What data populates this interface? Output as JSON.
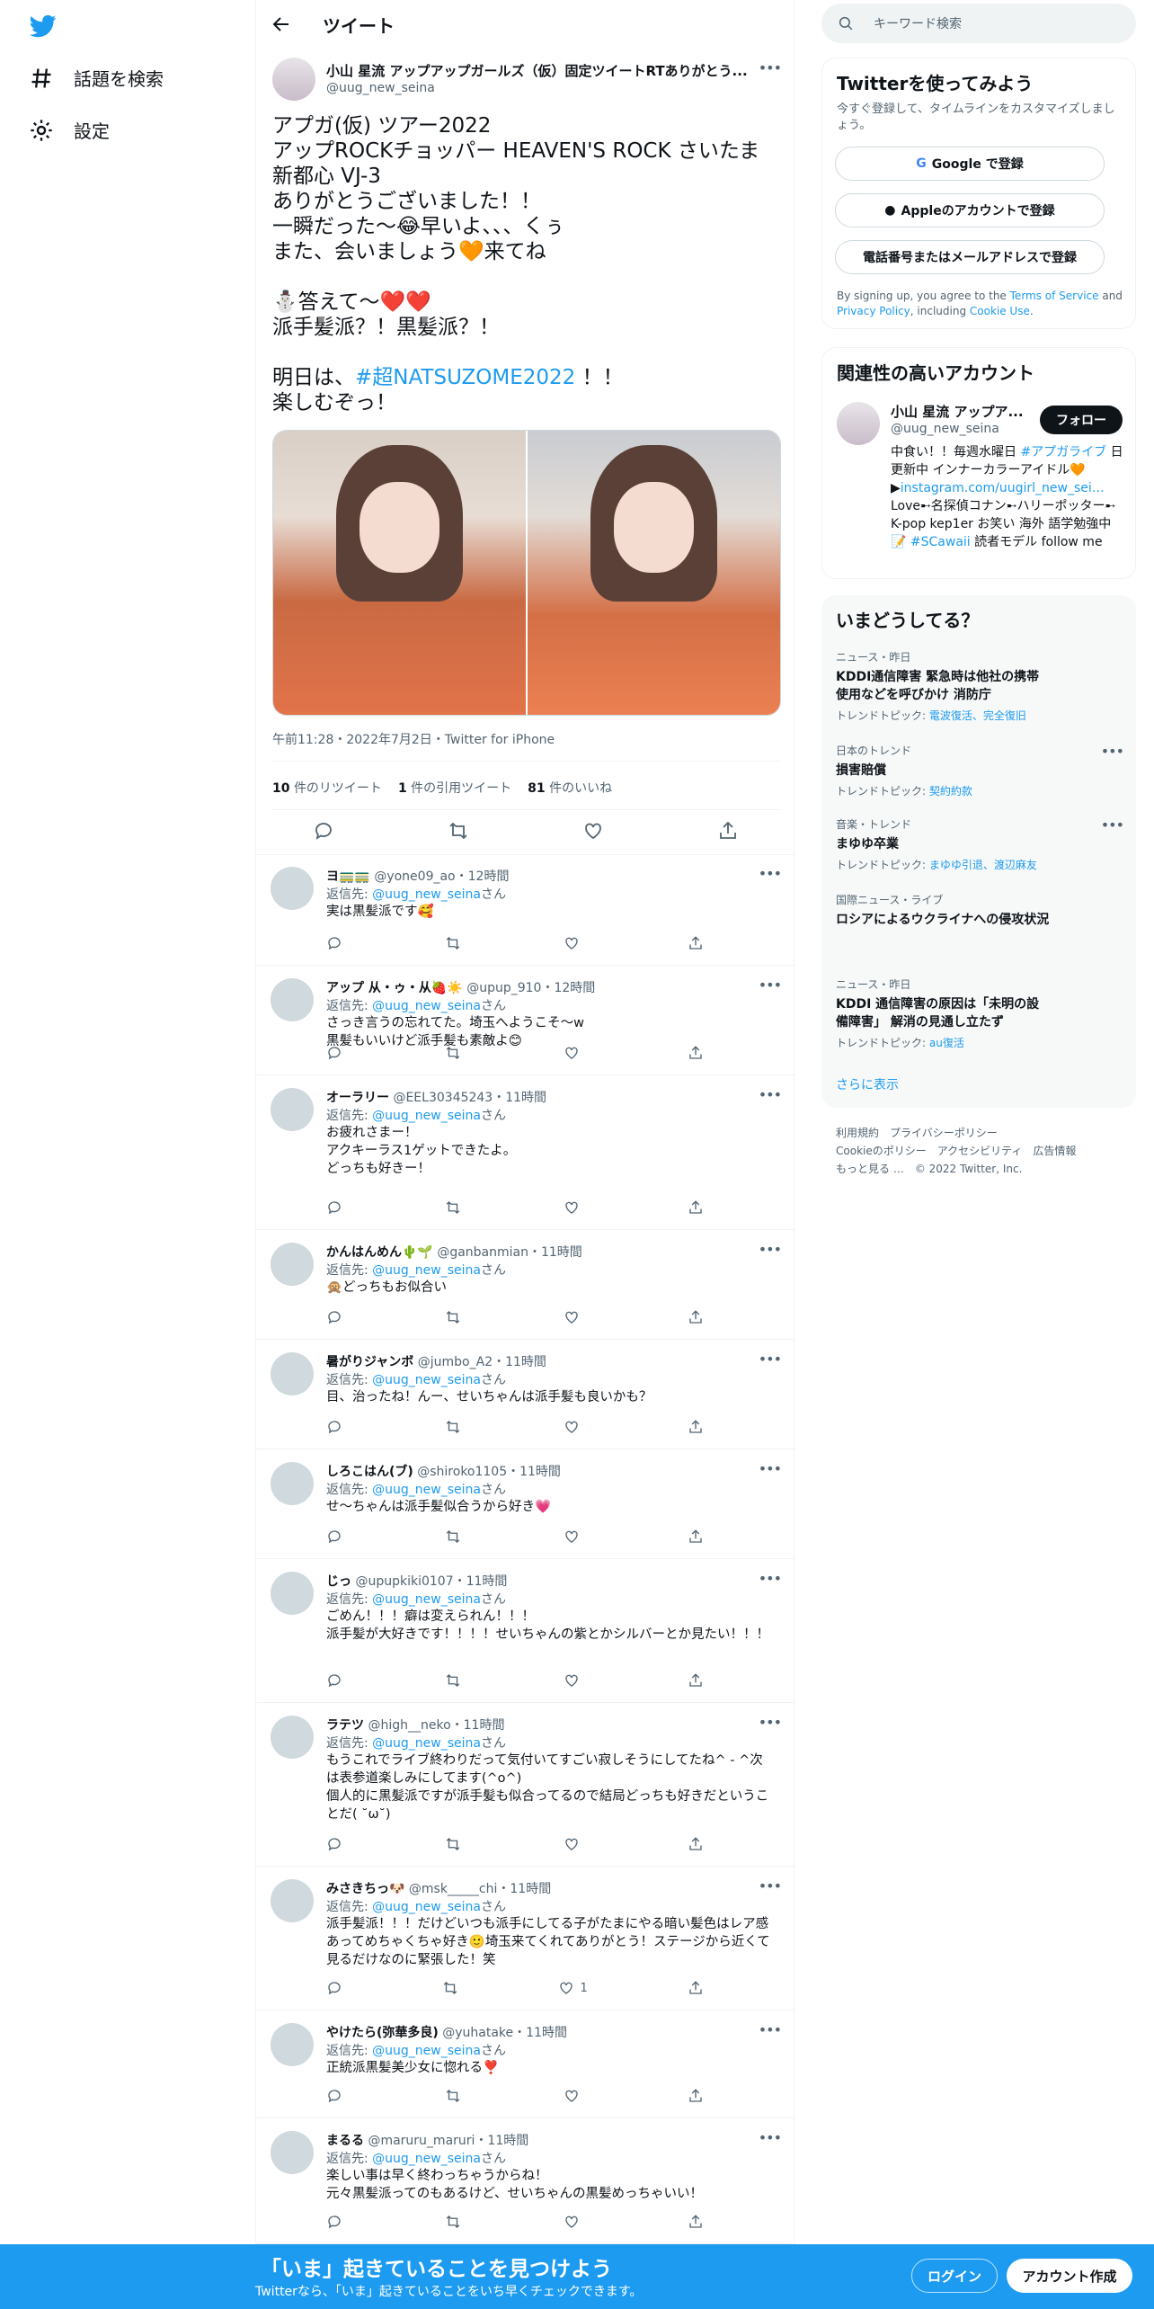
{
  "nav": {
    "explore_label": "話題を検索",
    "settings_label": "設定"
  },
  "header": {
    "title": "ツイート"
  },
  "tweet": {
    "author_name": "小山 星流 アップアップガールズ（仮）固定ツイートRTありがとう...",
    "author_handle": "@uug_new_seina",
    "body_lines": [
      "アプガ(仮) ツアー2022",
      "アップROCKチョッパー HEAVEN'S ROCK さいたま",
      "新都心 VJ-3",
      "ありがとうございました！！",
      "一瞬だった〜😂早いよ、、、くぅ",
      "また、会いましょう🧡来てね",
      "",
      "⛄答えて〜❤️❤️",
      "派手髪派？！黒髪派？！",
      ""
    ],
    "hashtag_prefix": "明日は、",
    "hashtag": "#超NATSUZOME2022",
    "hashtag_suffix": " ！！",
    "last_line": "楽しむぞっ！",
    "meta": "午前11:28・2022年7月2日・Twitter for iPhone",
    "retweets_count": "10",
    "retweets_label": "件のリツイート",
    "quotes_count": "1",
    "quotes_label": "件の引用ツイート",
    "likes_count": "81",
    "likes_label": "件のいいね"
  },
  "replies": [
    {
      "name": "ヨ🚃🚃",
      "handle": "@yone09_ao・12時間",
      "reply_to": "@uug_new_seina",
      "text": "実は黒髪派です🥰",
      "likes": ""
    },
    {
      "name": "アップ 从・ゥ・从🍓☀️",
      "handle": "@upup_910・12時間",
      "reply_to": "@uug_new_seina",
      "text": "さっき言うの忘れてた。埼玉へようこそ〜w\n黒髪もいいけど派手髪も素敵よ😊",
      "likes": ""
    },
    {
      "name": "オーラリー",
      "handle": "@EEL30345243・11時間",
      "reply_to": "@uug_new_seina",
      "text": "お疲れさまー！\nアクキーラス1ゲットできたよ。\nどっちも好きー！",
      "likes": ""
    },
    {
      "name": "かんはんめん🌵🌱",
      "handle": "@ganbanmian・11時間",
      "reply_to": "@uug_new_seina",
      "text": "🙊どっちもお似合い",
      "likes": ""
    },
    {
      "name": "暑がりジャンボ",
      "handle": "@jumbo_A2・11時間",
      "reply_to": "@uug_new_seina",
      "text": "目、治ったね！んー、せいちゃんは派手髪も良いかも？",
      "likes": ""
    },
    {
      "name": "しろこはん(ブ)",
      "handle": "@shiroko1105・11時間",
      "reply_to": "@uug_new_seina",
      "text": "せ～ちゃんは派手髪似合うから好き💗",
      "likes": ""
    },
    {
      "name": "じっ",
      "handle": "@upupkiki0107・11時間",
      "reply_to": "@uug_new_seina",
      "text": "ごめん！！！癖は変えられん！！！\n派手髪が大好きです！！！！せいちゃんの紫とかシルバーとか見たい！！！",
      "likes": ""
    },
    {
      "name": "ラテツ",
      "handle": "@high__neko・11時間",
      "reply_to": "@uug_new_seina",
      "text": "もうこれでライブ終わりだって気付いてすごい寂しそうにしてたね^ - ^次は表参道楽しみにしてます(^o^)\n個人的に黒髪派ですが派手髪も似合ってるので結局どっちも好きだということだ( ˘ω˘)",
      "likes": ""
    },
    {
      "name": "みさきちっ🐶",
      "handle": "@msk_____chi・11時間",
      "reply_to": "@uug_new_seina",
      "text": "派手髪派！！！だけどいつも派手にしてる子がたまにやる暗い髪色はレア感あってめちゃくちゃ好き🙂埼玉来てくれてありがとう！ステージから近くて見るだけなのに緊張した！笑",
      "likes": "1"
    },
    {
      "name": "やけたら(弥華多良)",
      "handle": "@yuhatake・11時間",
      "reply_to": "@uug_new_seina",
      "text": "正統派黒髪美少女に惚れる❣️",
      "likes": ""
    },
    {
      "name": "まるる",
      "handle": "@maruru_maruri・11時間",
      "reply_to": "@uug_new_seina",
      "text": "楽しい事は早く終わっちゃうからね！\n元々黒髪派ってのもあるけど、せいちゃんの黒髪めっちゃいい！",
      "likes": ""
    }
  ],
  "reply_prefix": "返信先: ",
  "reply_suffix": "さん",
  "right": {
    "search_placeholder": "キーワード検索",
    "signup_title": "Twitterを使ってみよう",
    "signup_sub": "今すぐ登録して、タイムラインをカスタマイズしましょう。",
    "google_btn": "Google で登録",
    "apple_btn": "Appleのアカウントで登録",
    "phone_btn": "電話番号またはメールアドレスで登録",
    "terms_pre": "By signing up, you agree to the ",
    "terms_link": "Terms of Service",
    "terms_and": " and ",
    "privacy_link": "Privacy Policy",
    "terms_incl": ", including ",
    "cookie_link": "Cookie Use",
    "terms_end": ".",
    "related_title": "関連性の高いアカウント",
    "related_name": "小山 星流 アップア...",
    "related_handle": "@uug_new_seina",
    "follow_btn": "フォロー",
    "bio_1": "中食い！！毎週水曜日 ",
    "bio_tag1": "#アプガライブ",
    "bio_2": " 日更新中 インナーカラーアイドル🧡▶",
    "bio_link": "instagram.com/uugirl_new_sei…",
    "bio_3": " Love➸名探偵コナン➸ハリーポッター➸ K-pop kep1er お笑い 海外 語学勉強中📝 ",
    "bio_tag2": "#SCawaii",
    "bio_4": " 読者モデル follow me",
    "trends_title": "いまどうしてる？",
    "trends": [
      {
        "cat": "ニュース・昨日",
        "title": "KDDI通信障害 緊急時は他社の携帯使用などを呼びかけ 消防庁",
        "sub_label": "トレンドトピック: ",
        "sub_links": "電波復活、完全復旧",
        "more": false
      },
      {
        "cat": "日本のトレンド",
        "title": "損害賠償",
        "sub_label": "トレンドトピック: ",
        "sub_links": "契約約款",
        "more": true
      },
      {
        "cat": "音楽・トレンド",
        "title": "まゆゆ卒業",
        "sub_label": "トレンドトピック: ",
        "sub_links": "まゆゆ引退、渡辺麻友",
        "more": true
      },
      {
        "cat": "国際ニュース・ライブ",
        "title": "ロシアによるウクライナへの侵攻状況",
        "sub_label": "",
        "sub_links": "",
        "more": false
      },
      {
        "cat": "ニュース・昨日",
        "title": "KDDI 通信障害の原因は「未明の設備障害」 解消の見通し立たず",
        "sub_label": "トレンドトピック: ",
        "sub_links": "au復活",
        "more": false
      }
    ],
    "show_more": "さらに表示",
    "footer_line1": "利用規約　プライバシーポリシー",
    "footer_line2": "Cookieのポリシー　アクセシビリティ　広告情報",
    "footer_line3": "もっと見る …　© 2022 Twitter, Inc."
  },
  "bottom": {
    "title": "「いま」起きていることを見つけよう",
    "sub": "Twitterなら、「いま」起きていることをいち早くチェックできます。",
    "login": "ログイン",
    "signup": "アカウント作成"
  },
  "colors": {
    "accent": "#1d9bf0",
    "text": "#0f1419",
    "muted": "#536471"
  }
}
